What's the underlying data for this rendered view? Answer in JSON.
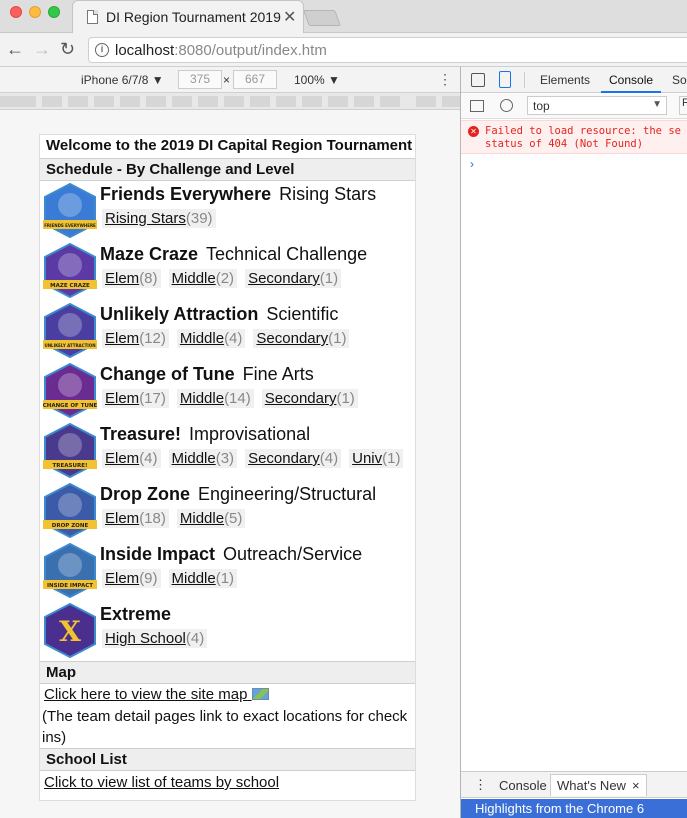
{
  "browser": {
    "tab_title": "DI Region Tournament 2019",
    "tab_close": "✕",
    "url_host": "localhost",
    "url_rest": ":8080/output/index.htm"
  },
  "device_toolbar": {
    "device": "iPhone 6/7/8 ▼",
    "width": "375",
    "times": "×",
    "height": "667",
    "zoom": "100% ▼"
  },
  "page": {
    "welcome": "Welcome to the 2019 DI Capital Region Tournament",
    "schedule_header": "Schedule - By Challenge and Level",
    "challenges": [
      {
        "name": "Friends Everywhere",
        "type": "Rising Stars",
        "badge_text": "FRIENDS EVERYWHERE",
        "badge_color": "#3a7bd5",
        "levels": [
          {
            "label": "Rising Stars",
            "count": "(39)"
          }
        ]
      },
      {
        "name": "Maze Craze",
        "type": "Technical Challenge",
        "badge_text": "MAZE CRAZE",
        "badge_color": "#5b3aa5",
        "levels": [
          {
            "label": "Elem",
            "count": "(8)"
          },
          {
            "label": "Middle",
            "count": "(2)"
          },
          {
            "label": "Secondary",
            "count": "(1)"
          }
        ]
      },
      {
        "name": "Unlikely Attraction",
        "type": "Scientific",
        "badge_text": "UNLIKELY ATTRACTION",
        "badge_color": "#4a3fa0",
        "levels": [
          {
            "label": "Elem",
            "count": "(12)"
          },
          {
            "label": "Middle",
            "count": "(4)"
          },
          {
            "label": "Secondary",
            "count": "(1)"
          }
        ]
      },
      {
        "name": "Change of Tune",
        "type": "Fine Arts",
        "badge_text": "CHANGE OF TUNE",
        "badge_color": "#6b2c91",
        "levels": [
          {
            "label": "Elem",
            "count": "(17)"
          },
          {
            "label": "Middle",
            "count": "(14)"
          },
          {
            "label": "Secondary",
            "count": "(1)"
          }
        ]
      },
      {
        "name": "Treasure!",
        "type": "Improvisational",
        "badge_text": "TREASURE!",
        "badge_color": "#4a3a8e",
        "levels": [
          {
            "label": "Elem",
            "count": "(4)"
          },
          {
            "label": "Middle",
            "count": "(3)"
          },
          {
            "label": "Secondary",
            "count": "(4)"
          },
          {
            "label": "Univ",
            "count": "(1)"
          }
        ]
      },
      {
        "name": "Drop Zone",
        "type": "Engineering/Structural",
        "badge_text": "DROP ZONE",
        "badge_color": "#3b5aa8",
        "levels": [
          {
            "label": "Elem",
            "count": "(18)"
          },
          {
            "label": "Middle",
            "count": "(5)"
          }
        ]
      },
      {
        "name": "Inside Impact",
        "type": "Outreach/Service",
        "badge_text": "INSIDE IMPACT",
        "badge_color": "#3a6fb0",
        "levels": [
          {
            "label": "Elem",
            "count": "(9)"
          },
          {
            "label": "Middle",
            "count": "(1)"
          }
        ]
      },
      {
        "name": "Extreme",
        "type": "",
        "badge_text": "X",
        "badge_color": "#4b2f8f",
        "levels": [
          {
            "label": "High School",
            "count": "(4)"
          }
        ]
      }
    ],
    "map_header": "Map",
    "map_link": "Click here to view the site map",
    "map_note": "(The team detail pages link to exact locations for check ins)",
    "school_header": "School List",
    "school_link": "Click to view list of teams by school"
  },
  "devtools": {
    "tab_elements": "Elements",
    "tab_console": "Console",
    "tab_sources": "So",
    "context": "top",
    "filter": "F",
    "error_line1": "Failed to load resource: the se",
    "error_line2": "status of 404 (Not Found)",
    "prompt": "›",
    "drawer_console": "Console",
    "drawer_whats_new": "What's New",
    "drawer_close": "×",
    "banner": "Highlights from the Chrome 6"
  },
  "colors": {
    "accent": "#1a73e8",
    "error": "#e5231c",
    "badge_gold": "#f2c230"
  }
}
